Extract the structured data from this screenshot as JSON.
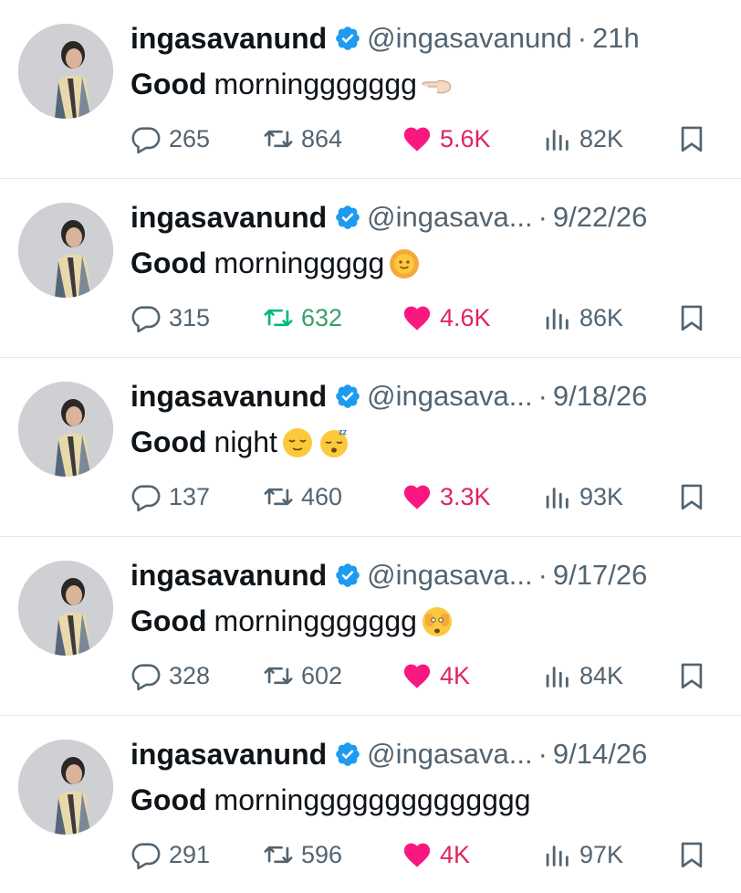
{
  "colors": {
    "like": "#f91880",
    "retweet_active": "#00ba7c",
    "muted": "#536471",
    "verified": "#1d9bf0"
  },
  "tweets": [
    {
      "name": "ingasavanund",
      "handle": "@ingasavanund",
      "sep": "·",
      "time": "21h",
      "lead": "Good",
      "text": "morninggggggg",
      "emoji": [
        "pointing-hand-emoji"
      ],
      "replies": "265",
      "retweets": "864",
      "likes": "5.6K",
      "views": "82K",
      "retweeted": false
    },
    {
      "name": "ingasavanund",
      "handle": "@ingasava...",
      "sep": "·",
      "time": "9/22/26",
      "lead": "Good",
      "text": "morninggggg",
      "emoji": [
        "sun-face-emoji"
      ],
      "replies": "315",
      "retweets": "632",
      "likes": "4.6K",
      "views": "86K",
      "retweeted": true
    },
    {
      "name": "ingasavanund",
      "handle": "@ingasava...",
      "sep": "·",
      "time": "9/18/26",
      "lead": "Good",
      "text": "night",
      "emoji": [
        "relieved-face-emoji",
        "sleeping-face-emoji"
      ],
      "replies": "137",
      "retweets": "460",
      "likes": "3.3K",
      "views": "93K",
      "retweeted": false
    },
    {
      "name": "ingasavanund",
      "handle": "@ingasava...",
      "sep": "·",
      "time": "9/17/26",
      "lead": "Good",
      "text": "morninggggggg",
      "emoji": [
        "peeking-face-emoji"
      ],
      "replies": "328",
      "retweets": "602",
      "likes": "4K",
      "views": "84K",
      "retweeted": false
    },
    {
      "name": "ingasavanund",
      "handle": "@ingasava...",
      "sep": "·",
      "time": "9/14/26",
      "lead": "Good",
      "text": "morningggggggggggggg",
      "emoji": [],
      "replies": "291",
      "retweets": "596",
      "likes": "4K",
      "views": "97K",
      "retweeted": false
    }
  ]
}
